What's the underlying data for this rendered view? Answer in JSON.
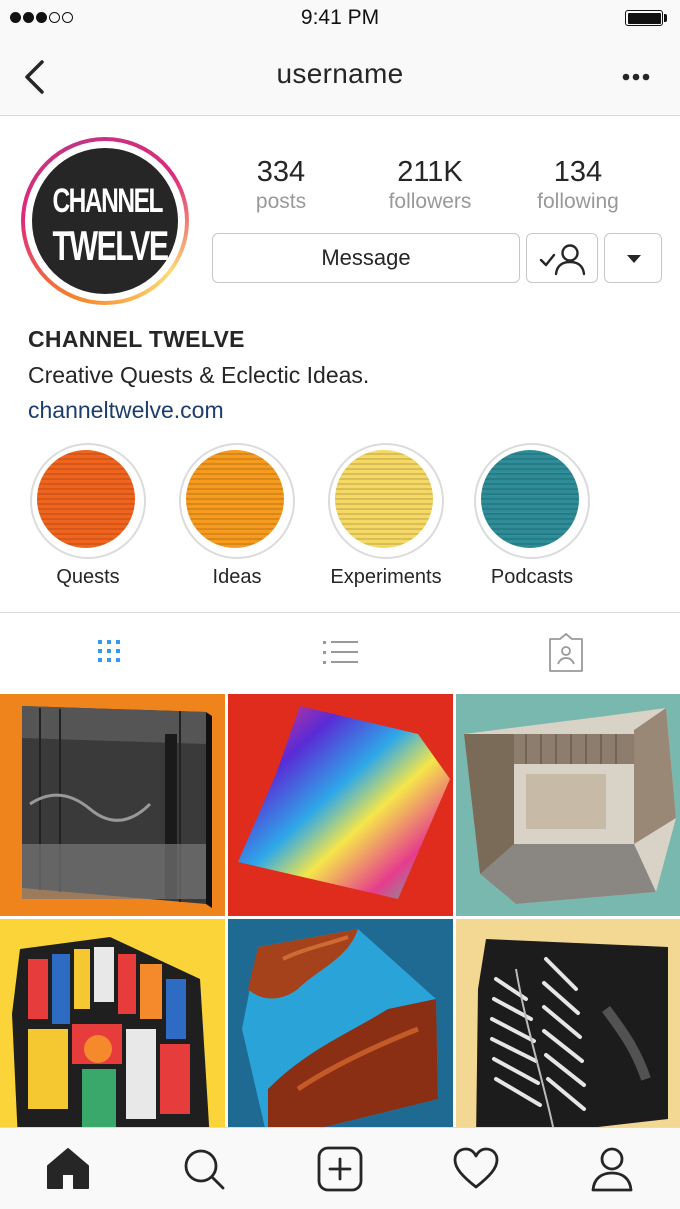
{
  "status_bar": {
    "time": "9:41 PM",
    "signal_bars": 3,
    "signal_total": 5
  },
  "nav": {
    "title": "username"
  },
  "profile": {
    "avatar_text_line1": "CHANNEL",
    "avatar_text_line2": "TWELVE",
    "stats": [
      {
        "value": "334",
        "label": "posts"
      },
      {
        "value": "211K",
        "label": "followers"
      },
      {
        "value": "134",
        "label": "following"
      }
    ],
    "message_button": "Message",
    "name": "CHANNEL TWELVE",
    "bio": "Creative Quests & Eclectic Ideas.",
    "website": "channeltwelve.com"
  },
  "highlights": [
    {
      "label": "Quests",
      "color": "#f0641e"
    },
    {
      "label": "Ideas",
      "color": "#f69b1e"
    },
    {
      "label": "Experiments",
      "color": "#f6d864"
    },
    {
      "label": "Podcasts",
      "color": "#2e8d99"
    }
  ],
  "tabs": [
    {
      "name": "grid",
      "active": true
    },
    {
      "name": "list",
      "active": false
    },
    {
      "name": "tagged",
      "active": false
    }
  ],
  "posts": [
    {
      "subject": "warehouse",
      "bg": "#f0841c"
    },
    {
      "subject": "holographic gradient",
      "bg": "#df2c1c"
    },
    {
      "subject": "building courtyard",
      "bg": "#78b8ae"
    },
    {
      "subject": "stained glass",
      "bg": "#fbd43a"
    },
    {
      "subject": "canyon",
      "bg": "#1f6a93"
    },
    {
      "subject": "leaves",
      "bg": "#f3d893"
    }
  ],
  "bottom_tabs": [
    "home",
    "search",
    "add",
    "activity",
    "profile"
  ],
  "colors": {
    "link": "#1b3d6d",
    "active_tab": "#3897f0",
    "border": "#dbdbdb"
  }
}
